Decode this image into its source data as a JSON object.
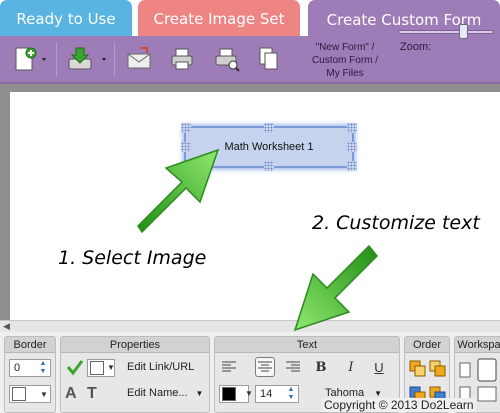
{
  "tabs": [
    {
      "label": "Ready to Use",
      "color": "#59b4e2"
    },
    {
      "label": "Create Image Set",
      "color": "#ef8485"
    },
    {
      "label": "Create Custom Form",
      "color": "#9d7cb8",
      "active": true
    }
  ],
  "toolbar": {
    "icons": [
      "new-page-icon",
      "download-icon",
      "email-icon",
      "print-icon",
      "print-preview-icon",
      "copy-icon"
    ],
    "breadcrumb": [
      "\"New Form\" /",
      "Custom Form /",
      "My Files"
    ],
    "zoom_label": "Zoom:",
    "zoom_level": 0.7
  },
  "canvas": {
    "selected_item_text": "Math Worksheet 1",
    "instruction_1": "1. Select Image",
    "instruction_2": "2. Customize text",
    "arrow_color": "#3cb521"
  },
  "panels": {
    "border": {
      "title": "Border",
      "value": "0"
    },
    "properties": {
      "title": "Properties",
      "edit_link": "Edit Link/URL",
      "edit_name": "Edit Name..."
    },
    "text": {
      "title": "Text",
      "font_size": "14",
      "font_name": "Tahoma",
      "bold": "B",
      "italic": "I",
      "underline": "U"
    },
    "order": {
      "title": "Order"
    },
    "workspace": {
      "title": "Workspa"
    }
  },
  "copyright": "Copyright © 2013 Do2Learn"
}
